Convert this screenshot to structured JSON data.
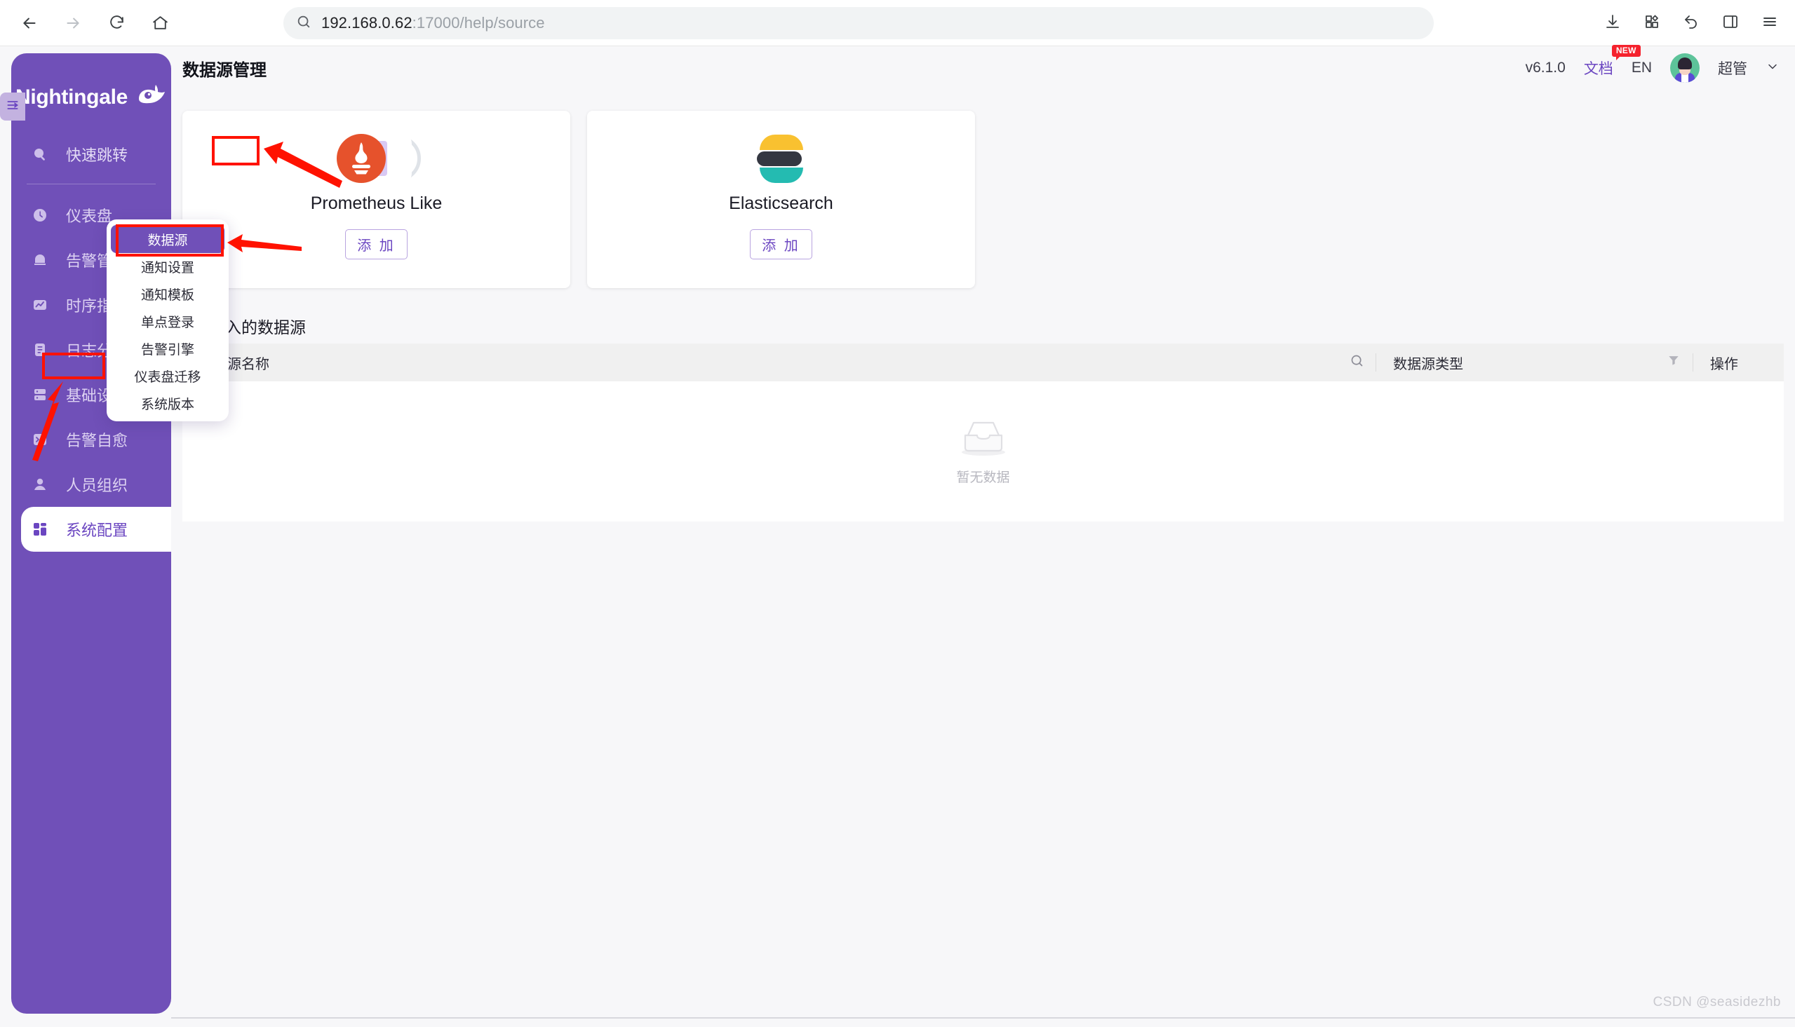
{
  "browser": {
    "url_host": "192.168.0.62",
    "url_path": ":17000/help/source",
    "icons": {
      "back": "back-arrow-icon",
      "forward": "forward-arrow-icon",
      "reload": "reload-icon",
      "home": "home-icon",
      "search": "search-icon",
      "download": "download-icon",
      "extensions": "extensions-icon",
      "undo": "undo-icon",
      "sidebar": "sidebar-panel-icon",
      "menu": "hamburger-menu-icon"
    }
  },
  "sidebar": {
    "brand": "Nightingale",
    "search_item": "快速跳转",
    "items": [
      {
        "label": "仪表盘",
        "icon": "dashboard-icon"
      },
      {
        "label": "告警管理",
        "icon": "alarm-bell-icon"
      },
      {
        "label": "时序指标",
        "icon": "line-chart-icon"
      },
      {
        "label": "日志分析",
        "icon": "document-log-icon"
      },
      {
        "label": "基础设施",
        "icon": "server-icon"
      },
      {
        "label": "告警自愈",
        "icon": "terminal-icon"
      },
      {
        "label": "人员组织",
        "icon": "user-icon"
      },
      {
        "label": "系统配置",
        "icon": "apps-grid-icon"
      }
    ],
    "active_index": 7
  },
  "flyout": {
    "items": [
      "数据源",
      "通知设置",
      "通知模板",
      "单点登录",
      "告警引擎",
      "仪表盘迁移",
      "系统版本"
    ],
    "selected_index": 0
  },
  "header": {
    "title": "数据源管理",
    "version": "v6.1.0",
    "doc_link": "文档",
    "doc_badge": "NEW",
    "language": "EN",
    "username": "超管",
    "chevron": "chevron-down-icon"
  },
  "cards": [
    {
      "name": "Prometheus Like",
      "add_label": "添 加",
      "logo": "prometheus-logo"
    },
    {
      "name": "Elasticsearch",
      "add_label": "添 加",
      "logo": "elasticsearch-logo"
    }
  ],
  "section": {
    "title": "已接入的数据源"
  },
  "table": {
    "columns": [
      "数据源名称",
      "数据源类型",
      "操作"
    ],
    "search_icon": "search-icon",
    "filter_icon": "filter-icon",
    "empty_text": "暂无数据",
    "rows": []
  },
  "watermark": "CSDN @seasidezhb",
  "colors": {
    "brand_purple": "#7050b8",
    "accent_purple": "#6b46c1",
    "annotation_red": "#ff1200",
    "prometheus_orange": "#e6522c",
    "es_yellow": "#f9c130",
    "es_dark": "#343741",
    "es_teal": "#24bbb1",
    "badge_red": "#f5222d"
  }
}
